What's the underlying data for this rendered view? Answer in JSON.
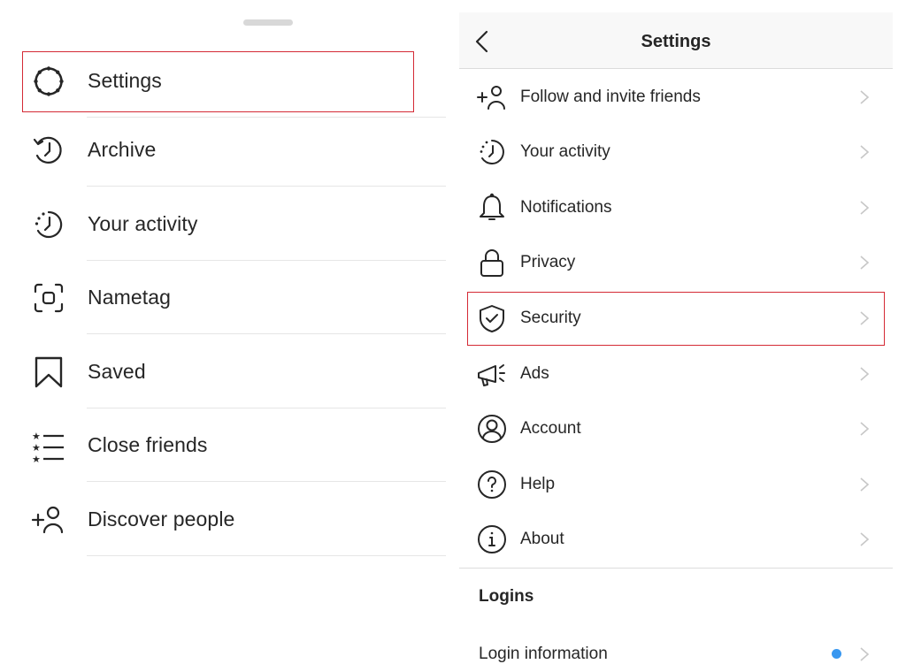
{
  "left_menu": {
    "items": [
      {
        "label": "Settings",
        "icon": "gear-icon"
      },
      {
        "label": "Archive",
        "icon": "archive-icon"
      },
      {
        "label": "Your activity",
        "icon": "activity-icon"
      },
      {
        "label": "Nametag",
        "icon": "nametag-icon"
      },
      {
        "label": "Saved",
        "icon": "bookmark-icon"
      },
      {
        "label": "Close friends",
        "icon": "close-friends-icon"
      },
      {
        "label": "Discover people",
        "icon": "add-person-icon"
      }
    ],
    "highlighted": "Settings"
  },
  "settings": {
    "title": "Settings",
    "back_icon": "chevron-left-icon",
    "items": [
      {
        "label": "Follow and invite friends",
        "icon": "add-person-icon"
      },
      {
        "label": "Your activity",
        "icon": "activity-icon"
      },
      {
        "label": "Notifications",
        "icon": "bell-icon"
      },
      {
        "label": "Privacy",
        "icon": "lock-icon"
      },
      {
        "label": "Security",
        "icon": "shield-check-icon"
      },
      {
        "label": "Ads",
        "icon": "megaphone-icon"
      },
      {
        "label": "Account",
        "icon": "account-circle-icon"
      },
      {
        "label": "Help",
        "icon": "help-icon"
      },
      {
        "label": "About",
        "icon": "info-icon"
      }
    ],
    "highlighted": "Security",
    "section": {
      "title": "Logins",
      "items": [
        {
          "label": "Login information",
          "badge": "unread-dot",
          "badge_color": "#3897f0"
        }
      ]
    }
  },
  "colors": {
    "highlight_border": "#d42a35",
    "text": "#262626",
    "chevron": "#c7c7c7",
    "header_bg": "#f8f8f8",
    "badge_blue": "#3897f0"
  }
}
